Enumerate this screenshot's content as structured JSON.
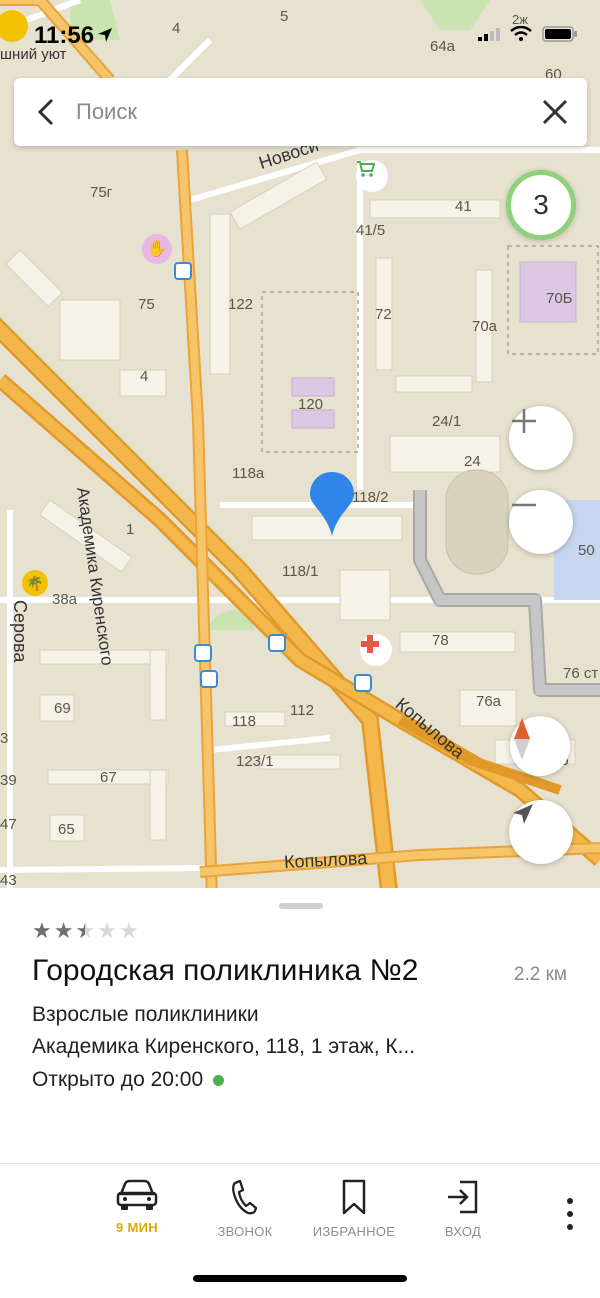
{
  "status_bar": {
    "time": "11:56",
    "back_app": "шний уют"
  },
  "search": {
    "placeholder": "Поиск"
  },
  "map": {
    "traffic_level": "3",
    "streets": [
      "Новосибирская",
      "Академика Киренского",
      "Копылова",
      "Копылова",
      "Серова"
    ],
    "house_numbers": [
      "4",
      "5",
      "2ж",
      "64а",
      "60",
      "75г",
      "41",
      "41/5",
      "75",
      "122",
      "72",
      "70а",
      "70Б",
      "4",
      "120",
      "24/1",
      "24",
      "118а",
      "118/2",
      "1",
      "118/1",
      "50",
      "38а",
      "78",
      "76 ст",
      "69",
      "112",
      "76а",
      "118",
      "123/1",
      "67",
      "76",
      "65",
      "3",
      "39",
      "47",
      "43"
    ],
    "street_label_map": "Новоси"
  },
  "place": {
    "rating": 2.5,
    "name": "Городская поликлиника №2",
    "distance": "2.2 км",
    "category": "Взрослые поликлиники",
    "address": "Академика Киренского, 118, 1 этаж, К...",
    "hours": "Открыто до 20:00"
  },
  "tabs": [
    {
      "label": "9 МИН",
      "icon": "car-icon"
    },
    {
      "label": "ЗВОНОК",
      "icon": "phone-icon"
    },
    {
      "label": "ИЗБРАННОЕ",
      "icon": "bookmark-icon"
    },
    {
      "label": "ВХОД",
      "icon": "login-icon"
    }
  ],
  "colors": {
    "accent": "#e0a800",
    "map_bg": "#e7e2cf",
    "road": "#f0a833",
    "open": "#4caf50",
    "pin": "#2f86e8"
  }
}
